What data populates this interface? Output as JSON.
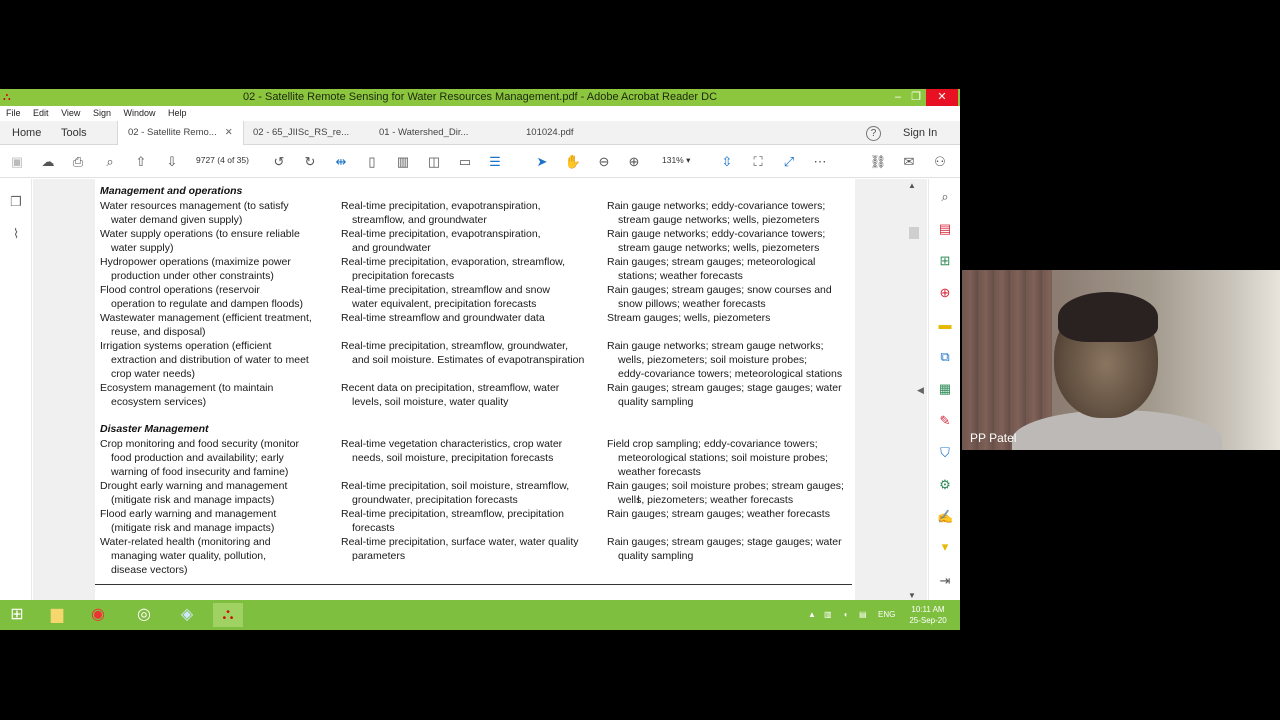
{
  "window": {
    "title": "02 - Satellite Remote Sensing for Water Resources Management.pdf - Adobe Acrobat Reader DC",
    "close_glyph": "✕",
    "minimize_glyph": "–",
    "restore_glyph": "❐"
  },
  "menu": [
    "File",
    "Edit",
    "View",
    "Sign",
    "Window",
    "Help"
  ],
  "tabs": {
    "home": "Home",
    "tools": "Tools",
    "docs": [
      {
        "label": "02 - Satellite Remo...",
        "active": true
      },
      {
        "label": "02 - 65_JIISc_RS_re..."
      },
      {
        "label": "01 - Watershed_Dir..."
      },
      {
        "label": "101024.pdf"
      }
    ],
    "help": "?",
    "sign_in": "Sign In"
  },
  "toolbar": {
    "page_number": "9727",
    "page_count": "(4 of 35)",
    "zoom": "131%"
  },
  "document": {
    "sections": [
      {
        "heading": "Management and operations",
        "rows": [
          {
            "c1": [
              "Water resources management (to satisfy",
              "water demand given supply)"
            ],
            "c2": [
              "Real-time precipitation, evapotranspiration,",
              "streamflow, and groundwater"
            ],
            "c3": [
              "Rain gauge networks; eddy-covariance towers;",
              "stream gauge networks; wells, piezometers"
            ]
          },
          {
            "c1": [
              "Water supply operations (to ensure reliable",
              "water supply)"
            ],
            "c2": [
              "Real-time precipitation, evapotranspiration,",
              "and groundwater"
            ],
            "c3": [
              "Rain gauge networks; eddy-covariance towers;",
              "stream gauge networks; wells, piezometers"
            ]
          },
          {
            "c1": [
              "Hydropower operations (maximize power",
              "production under other constraints)"
            ],
            "c2": [
              "Real-time precipitation, evaporation, streamflow,",
              "precipitation forecasts"
            ],
            "c3": [
              "Rain gauges; stream gauges; meteorological",
              "stations; weather forecasts"
            ]
          },
          {
            "c1": [
              "Flood control operations (reservoir",
              "operation to regulate and dampen floods)"
            ],
            "c2": [
              "Real-time precipitation, streamflow and snow",
              "water equivalent, precipitation forecasts"
            ],
            "c3": [
              "Rain gauges; stream gauges; snow courses and",
              "snow pillows; weather forecasts"
            ]
          },
          {
            "c1": [
              "Wastewater management (efficient treatment,",
              "reuse, and disposal)"
            ],
            "c2": [
              "Real-time streamflow and groundwater data"
            ],
            "c3": [
              "Stream gauges; wells, piezometers"
            ]
          },
          {
            "c1": [
              "Irrigation systems operation (efficient",
              "extraction and distribution of water to meet",
              "crop water needs)"
            ],
            "c2": [
              "Real-time precipitation, streamflow, groundwater,",
              "and soil moisture. Estimates of evapotranspiration"
            ],
            "c3": [
              "Rain gauge networks; stream gauge networks;",
              "wells, piezometers; soil moisture probes;",
              "eddy-covariance towers; meteorological stations"
            ]
          },
          {
            "c1": [
              "Ecosystem management (to maintain",
              "ecosystem services)"
            ],
            "c2": [
              "Recent data on precipitation, streamflow, water",
              "levels, soil moisture, water quality"
            ],
            "c3": [
              "Rain gauges; stream gauges; stage gauges; water",
              "quality sampling"
            ]
          }
        ]
      },
      {
        "heading": "Disaster Management",
        "rows": [
          {
            "c1": [
              "Crop monitoring and food security (monitor",
              "food production and availability; early",
              "warning of food insecurity and famine)"
            ],
            "c2": [
              "Real-time vegetation characteristics, crop water",
              "needs, soil moisture, precipitation forecasts"
            ],
            "c3": [
              "Field crop sampling; eddy-covariance towers;",
              "meteorological stations; soil moisture probes;",
              "weather forecasts"
            ]
          },
          {
            "c1": [
              "Drought early warning and management",
              "(mitigate risk and manage impacts)"
            ],
            "c2": [
              "Real-time precipitation, soil moisture, streamflow,",
              "groundwater, precipitation forecasts"
            ],
            "c3": [
              "Rain gauges; soil moisture probes; stream gauges;",
              "wells, piezometers; weather forecasts"
            ]
          },
          {
            "c1": [
              "Flood early warning and management",
              "(mitigate risk and manage impacts)"
            ],
            "c2": [
              "Real-time precipitation, streamflow, precipitation",
              "forecasts"
            ],
            "c3": [
              "Rain gauges; stream gauges; weather forecasts"
            ]
          },
          {
            "c1": [
              "Water-related health (monitoring and",
              "managing water quality, pollution,",
              "disease vectors)"
            ],
            "c2": [
              "Real-time precipitation, surface water, water quality",
              "parameters"
            ],
            "c3": [
              "Rain gauges; stream gauges; stage gauges; water",
              "quality sampling"
            ]
          }
        ]
      }
    ]
  },
  "taskbar": {
    "language": "ENG",
    "time": "10:11 AM",
    "date": "25-Sep-20"
  },
  "webcam": {
    "participant_name": "PP Patel"
  },
  "colors": {
    "title_bar": "#8cc63f",
    "taskbar": "#7fbf3f",
    "close": "#e81123",
    "accent_blue": "#1a73c8"
  }
}
